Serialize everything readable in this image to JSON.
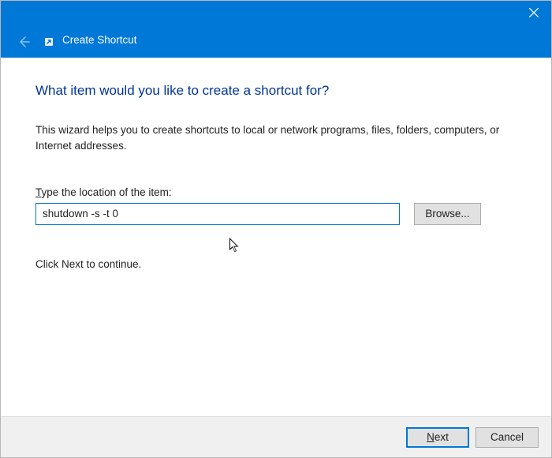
{
  "titlebar": {
    "title": "Create Shortcut"
  },
  "content": {
    "heading": "What item would you like to create a shortcut for?",
    "description": "This wizard helps you to create shortcuts to local or network programs, files, folders, computers, or Internet addresses.",
    "field_label_first": "T",
    "field_label_rest": "ype the location of the item:",
    "location_value": "shutdown -s -t 0",
    "browse_label": "Browse...",
    "continue_text": "Click Next to continue."
  },
  "footer": {
    "next_first": "N",
    "next_rest": "ext",
    "cancel_label": "Cancel"
  }
}
